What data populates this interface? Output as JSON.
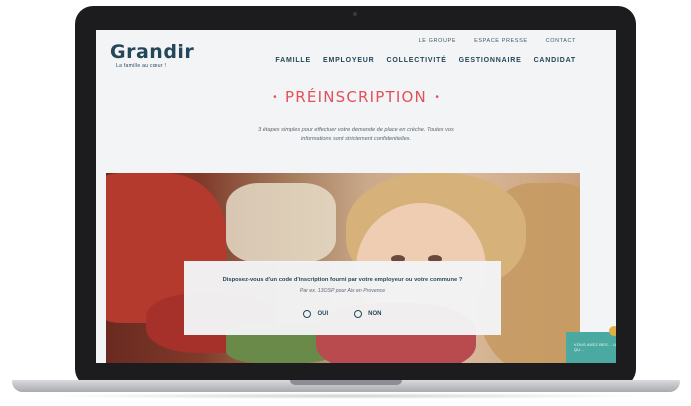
{
  "brand": {
    "name": "Grandir",
    "tagline": "La famille au cœur !"
  },
  "top_links": [
    "LE GROUPE",
    "ESPACE PRESSE",
    "CONTACT"
  ],
  "main_nav": [
    "FAMILLE",
    "EMPLOYEUR",
    "COLLECTIVITÉ",
    "GESTIONNAIRE",
    "CANDIDAT"
  ],
  "page": {
    "title": "PRÉINSCRIPTION",
    "intro": "3 étapes simples pour effectuer votre demande de place en crèche. Toutes vos informations sont strictement confidentielles."
  },
  "question": {
    "text": "Disposez-vous d'un code d'inscription fourni par votre employeur ou votre commune ?",
    "hint": "Par ex. 13OSP pour Aix en Provence",
    "options": [
      "OUI",
      "NON"
    ]
  },
  "side_tab": {
    "text": "VOUS AVEZ BES... UNE QU..."
  },
  "colors": {
    "accent": "#e2505a",
    "brand": "#24475a",
    "teal": "#4aa9a0"
  }
}
